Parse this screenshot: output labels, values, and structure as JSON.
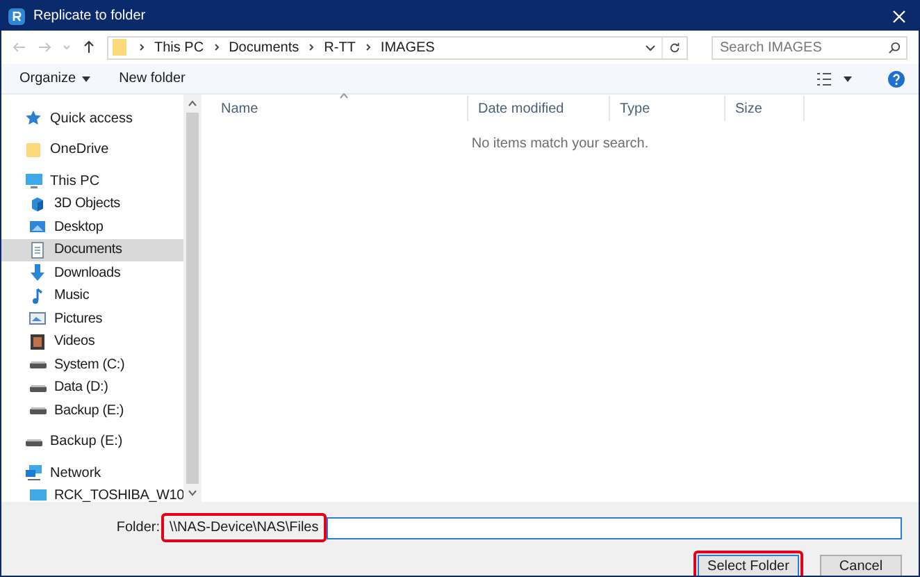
{
  "window": {
    "title": "Replicate to folder"
  },
  "address": {
    "path": [
      {
        "label": "This PC"
      },
      {
        "label": "Documents"
      },
      {
        "label": "R-TT"
      },
      {
        "label": "IMAGES"
      }
    ],
    "search_placeholder": "Search IMAGES"
  },
  "toolbar": {
    "organize": "Organize",
    "new_folder": "New folder"
  },
  "sidebar": {
    "items": [
      {
        "label": "Quick access",
        "kind": "star",
        "selected": false
      },
      {
        "label": "OneDrive",
        "kind": "folder",
        "selected": false
      },
      {
        "label": "This PC",
        "kind": "pc",
        "selected": false,
        "children": [
          {
            "label": "3D Objects",
            "kind": "cube",
            "selected": false
          },
          {
            "label": "Desktop",
            "kind": "desktop",
            "selected": false
          },
          {
            "label": "Documents",
            "kind": "doc",
            "selected": true
          },
          {
            "label": "Downloads",
            "kind": "download",
            "selected": false
          },
          {
            "label": "Music",
            "kind": "music",
            "selected": false
          },
          {
            "label": "Pictures",
            "kind": "picture",
            "selected": false
          },
          {
            "label": "Videos",
            "kind": "video",
            "selected": false
          },
          {
            "label": "System (C:)",
            "kind": "drive",
            "selected": false
          },
          {
            "label": "Data (D:)",
            "kind": "drive",
            "selected": false
          },
          {
            "label": "Backup (E:)",
            "kind": "drive",
            "selected": false
          }
        ]
      },
      {
        "label": "Backup (E:)",
        "kind": "drive",
        "selected": false
      },
      {
        "label": "Network",
        "kind": "network",
        "selected": false,
        "children": [
          {
            "label": "RCK_TOSHIBA_W10",
            "kind": "pc",
            "selected": false
          }
        ]
      }
    ]
  },
  "table": {
    "columns": [
      "Name",
      "Date modified",
      "Type",
      "Size"
    ],
    "empty_message": "No items match your search."
  },
  "folder_field": {
    "label": "Folder:",
    "value": "\\\\NAS-Device\\NAS\\Files"
  },
  "buttons": {
    "select": "Select Folder",
    "cancel": "Cancel"
  }
}
